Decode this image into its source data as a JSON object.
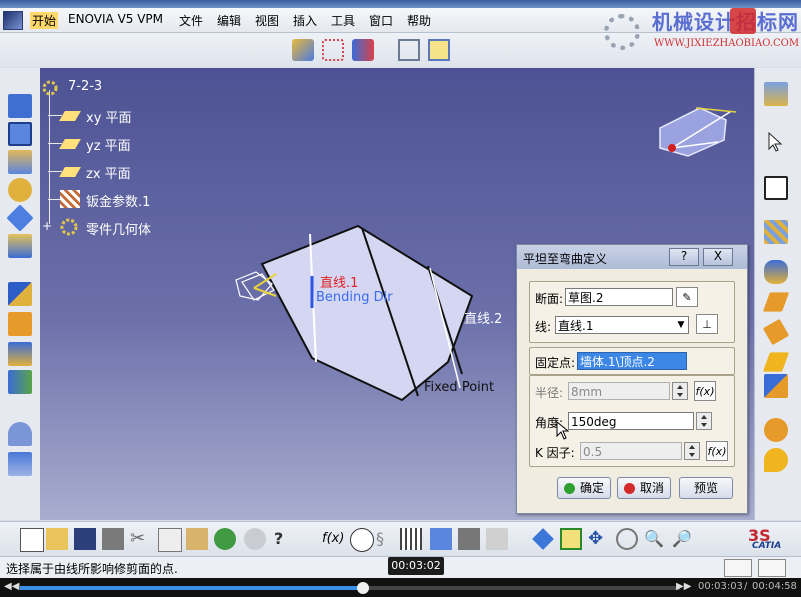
{
  "menu": {
    "items": [
      "开始",
      "ENOVIA V5 VPM",
      "文件",
      "编辑",
      "视图",
      "插入",
      "工具",
      "窗口",
      "帮助"
    ]
  },
  "watermark": {
    "title": "机械设计招标网",
    "url": "WWW.JIXIEZHAOBIAO.COM"
  },
  "tree": {
    "root": "7-2-3",
    "items": [
      {
        "label": "xy 平面",
        "icon": "plane-icon"
      },
      {
        "label": "yz 平面",
        "icon": "plane-icon"
      },
      {
        "label": "zx 平面",
        "icon": "plane-icon"
      },
      {
        "label": "钣金参数.1",
        "icon": "sheetmetal-params-icon"
      },
      {
        "label": "零件几何体",
        "icon": "part-body-icon"
      }
    ]
  },
  "model": {
    "label_line1": "直线.1",
    "label_bending": "Bending Dir",
    "label_line2": "直线.2",
    "label_fixed": "Fixed Point"
  },
  "dialog": {
    "title": "平坦至弯曲定义",
    "help_btn": "?",
    "close_btn": "X",
    "profile_label": "断面:",
    "profile_value": "草图.2",
    "line_label": "线:",
    "line_value": "直线.1",
    "fixed_label": "固定点:",
    "fixed_value": "墙体.1\\顶点.2",
    "radius_label": "半径:",
    "radius_value": "8mm",
    "angle_label": "角度:",
    "angle_value": "150deg",
    "kfactor_label": "K 因子:",
    "kfactor_value": "0.5",
    "fx_label": "f(x)",
    "ok_label": "确定",
    "cancel_label": "取消",
    "preview_label": "预览"
  },
  "status": {
    "message": "选择属于由线所影响修剪面的点."
  },
  "player": {
    "tooltip_time": "00:03:02",
    "current_time": "00:03:03",
    "total_time": "00:04:58",
    "progress": 0.52
  },
  "catia_logo": "CATIA"
}
